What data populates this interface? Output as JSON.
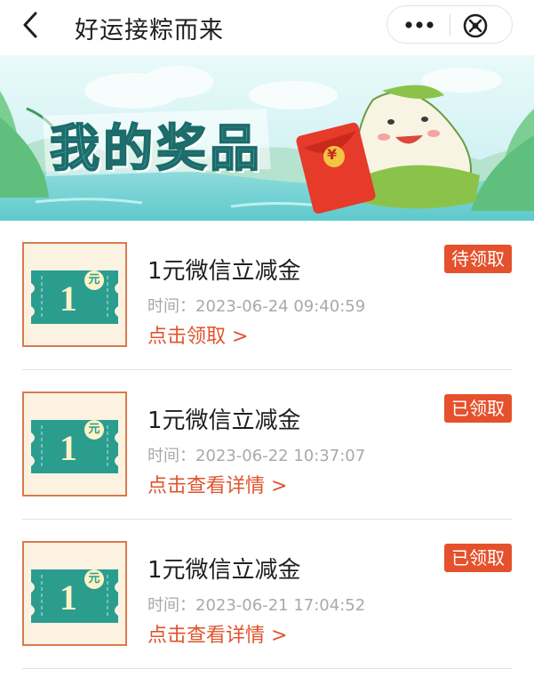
{
  "header": {
    "title": "好运接粽而来",
    "back_icon": "chevron-left-icon",
    "more_icon": "more-dots-icon",
    "close_icon": "close-circle-icon"
  },
  "banner": {
    "title": "我的奖品",
    "coin_symbol": "¥",
    "colors": {
      "sky": "#cdeff2",
      "water": "#7fd3d7",
      "title_fill": "#4fc0c3",
      "envelope": "#e63a2a"
    }
  },
  "prizes": [
    {
      "ticket_value": "1",
      "ticket_unit": "元",
      "name": "1元微信立减金",
      "time": "时间：2023-06-24 09:40:59",
      "link": "点击领取 >",
      "status": "待领取"
    },
    {
      "ticket_value": "1",
      "ticket_unit": "元",
      "name": "1元微信立减金",
      "time": "时间：2023-06-22 10:37:07",
      "link": "点击查看详情 >",
      "status": "已领取"
    },
    {
      "ticket_value": "1",
      "ticket_unit": "元",
      "name": "1元微信立减金",
      "time": "时间：2023-06-21 17:04:52",
      "link": "点击查看详情 >",
      "status": "已领取"
    }
  ],
  "colors": {
    "accent": "#e5512c",
    "ticket_teal": "#2a9d8f",
    "ticket_bg": "#fbf2e2",
    "ticket_border": "#d97a4c"
  }
}
